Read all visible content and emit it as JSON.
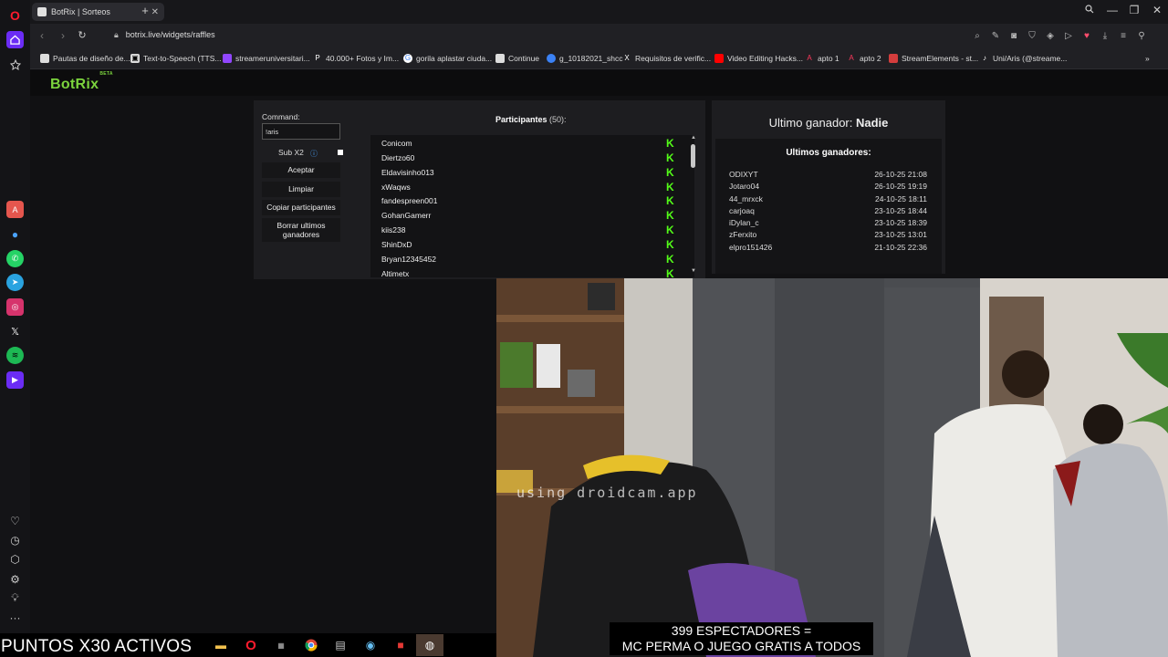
{
  "browser": {
    "tab_title": "BotRix | Sorteos",
    "url": "botrix.live/widgets/raffles",
    "bookmarks": [
      "Pautas de diseño de...",
      "Text-to-Speech (TTS...",
      "streameruniversitari...",
      "40.000+ Fotos y Im...",
      "gorila aplastar ciuda...",
      "Continue",
      "g_10182021_shcc",
      "Requisitos de verific...",
      "Video Editing Hacks...",
      "apto 1",
      "apto 2",
      "StreamElements - st...",
      "Uni/Aris (@streame..."
    ]
  },
  "botrix": {
    "logo": "BotRix",
    "logo_badge": "BETA",
    "command_label": "Command:",
    "command_value": "!aris",
    "sub_label": "Sub X2",
    "info_icon": "ⓘ",
    "buttons": {
      "accept": "Aceptar",
      "clear": "Limpiar",
      "copy": "Copiar participantes",
      "delete_line1": "Borrar ultimos",
      "delete_line2": "ganadores"
    },
    "participants_title": "Participantes",
    "participants_count": "(50):",
    "participants": [
      "Conicom",
      "Diertzo60",
      "Eldavisinho013",
      "xWaqws",
      "fandespreen001",
      "GohanGamerr",
      "kiis238",
      "ShinDxD",
      "Bryan12345452",
      "Altimetx"
    ],
    "last_winner_label": "Ultimo ganador:",
    "last_winner_value": "Nadie",
    "winners_title": "Ultimos ganadores:",
    "winners": [
      {
        "name": "ODIXYT",
        "date": "26-10-25 21:08"
      },
      {
        "name": "Jotaro04",
        "date": "26-10-25 19:19"
      },
      {
        "name": "44_mrxck",
        "date": "24-10-25 18:11"
      },
      {
        "name": "carjoaq",
        "date": "23-10-25 18:44"
      },
      {
        "name": "iDylan_c",
        "date": "23-10-25 18:39"
      },
      {
        "name": "zFerxito",
        "date": "23-10-25 13:01"
      },
      {
        "name": "elpro151426",
        "date": "21-10-25 22:36"
      }
    ]
  },
  "stream": {
    "watermark": "using droidcam.app",
    "bottom_left": "PUNTOS X30 ACTIVOS",
    "overlay_line1": "399 ESPECTADORES =",
    "overlay_line2": "MC PERMA O JUEGO GRATIS A TODOS"
  },
  "colors": {
    "accent_green": "#7bd33d",
    "kick_green": "#53fc18"
  }
}
